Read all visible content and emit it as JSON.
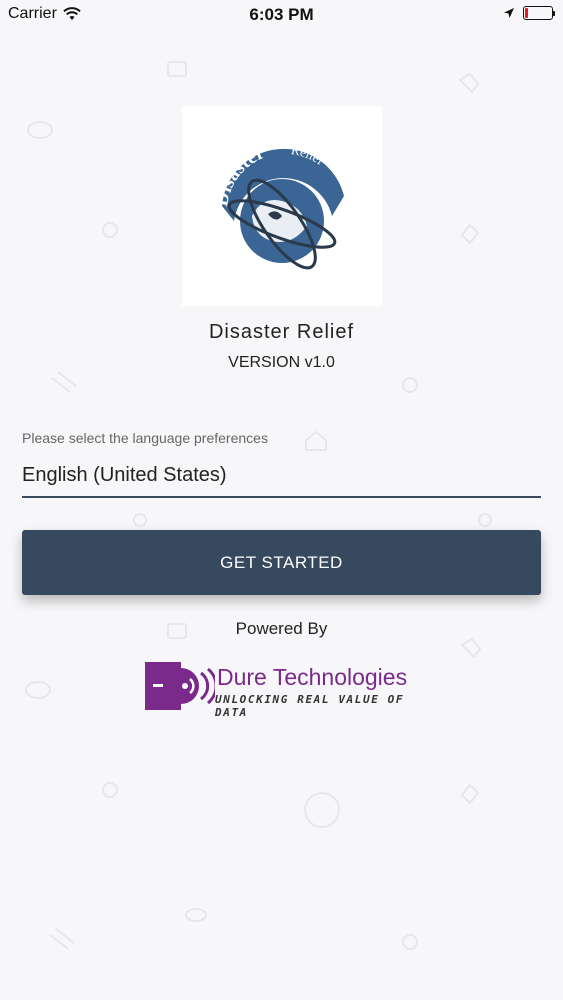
{
  "status_bar": {
    "carrier": "Carrier",
    "time": "6:03 PM"
  },
  "app": {
    "name": "Disaster Relief",
    "version": "VERSION v1.0",
    "logo_text": [
      "Disaster",
      "Relief"
    ]
  },
  "language": {
    "label": "Please select the language preferences",
    "selected": "English (United States)"
  },
  "actions": {
    "get_started": "GET STARTED"
  },
  "footer": {
    "powered_by": "Powered By",
    "company_name": "Dure Technologies",
    "tagline": "UNLOCKING REAL VALUE OF DATA"
  },
  "colors": {
    "background": "#f7f7f9",
    "primary_button": "#36495f",
    "brand_purple": "#7a2a8a",
    "logo_blue": "#3a6595"
  }
}
